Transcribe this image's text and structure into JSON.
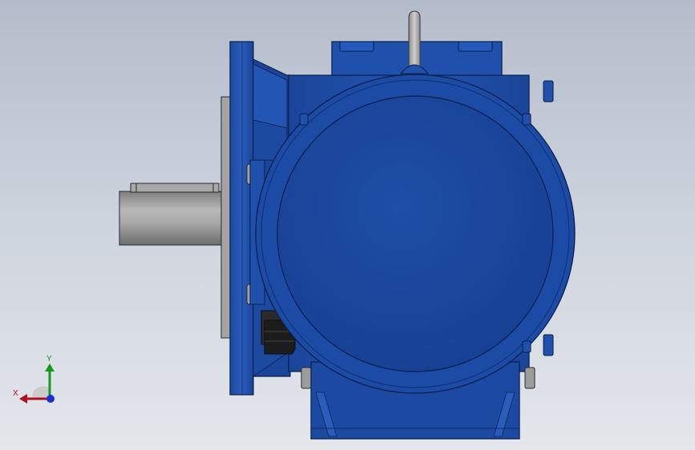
{
  "triad": {
    "x_label": "X",
    "y_label": "Y",
    "x_color": "#b0101a",
    "y_color": "#129a1e",
    "z_color": "#1a2fd6"
  },
  "colors": {
    "background_top": "#b4bccb",
    "background_bottom": "#e4e7ec",
    "body_blue": "#1f4fa6",
    "body_blue_dark": "#0f2f73",
    "shaft_gray": "#9a9a9a",
    "steel_gray": "#a5a5a5"
  },
  "icons": {
    "triad": "coordinate-triad-icon",
    "lifting_eye": "lifting-eye-bolt-icon"
  }
}
